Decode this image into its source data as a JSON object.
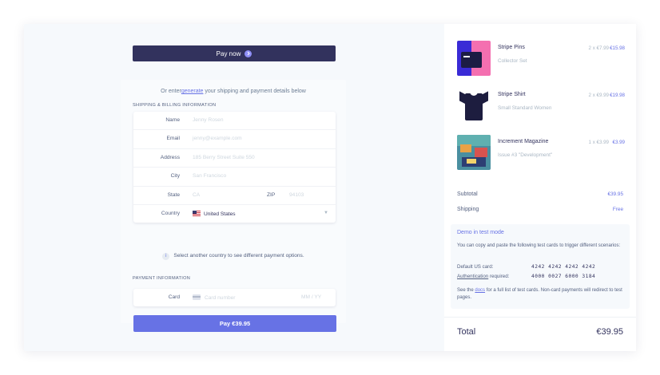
{
  "pay_now": {
    "label": "Pay now",
    "icon": "arrow-right-circle-icon"
  },
  "intro": {
    "prefix": "Or enter",
    "link": "generate",
    "suffix": " your shipping and payment details below"
  },
  "shipping_section": {
    "title": "Shipping & Billing Information"
  },
  "fields": {
    "name": {
      "label": "Name",
      "placeholder": "Jenny Rosen"
    },
    "email": {
      "label": "Email",
      "placeholder": "jenny@example.com"
    },
    "address": {
      "label": "Address",
      "placeholder": "185 Berry Street Suite 550"
    },
    "city": {
      "label": "City",
      "placeholder": "San Francisco"
    },
    "state": {
      "label": "State",
      "placeholder": "CA"
    },
    "zip": {
      "label": "ZIP",
      "placeholder": "94103"
    },
    "country": {
      "label": "Country",
      "value": "United States",
      "flag": "us-flag-icon"
    }
  },
  "country_note": {
    "icon": "info-icon",
    "icon_text": "i",
    "text": "Select another country to see different payment options."
  },
  "payment_section": {
    "title": "Payment Information"
  },
  "card_field": {
    "label": "Card",
    "placeholder": "Card number",
    "expiry_placeholder": "MM / YY"
  },
  "pay_button": {
    "label": "Pay €39.95"
  },
  "cart": {
    "items": [
      {
        "name": "Stripe Pins",
        "sub": "Collector Set",
        "qty": "2 x €7.99",
        "price": "€15.98"
      },
      {
        "name": "Stripe Shirt",
        "sub": "Small Standard Women",
        "qty": "2 x €9.99",
        "price": "€19.98"
      },
      {
        "name": "Increment Magazine",
        "sub": "Issue #3 \"Development\"",
        "qty": "1 x €3.99",
        "price": "€3.99"
      }
    ],
    "subtotal_label": "Subtotal",
    "subtotal_value": "€39.95",
    "shipping_label": "Shipping",
    "shipping_value": "Free",
    "total_label": "Total",
    "total_value": "€39.95"
  },
  "demo": {
    "title": "Demo in test mode",
    "description": "You can copy and paste the following test cards to trigger different scenarios:",
    "rows": [
      {
        "label": "Default US card:",
        "number": "4242 4242 4242 4242"
      },
      {
        "label": "Authentication",
        "label_suffix": " required:",
        "number": "4000 0027 6000 3184"
      }
    ],
    "footer_prefix": "See the ",
    "footer_link": "docs",
    "footer_suffix": " for a full list of test cards. Non-card payments will redirect to test pages."
  },
  "colors": {
    "accent": "#6772e5",
    "dark": "#32325d",
    "muted": "#aab7c4"
  }
}
